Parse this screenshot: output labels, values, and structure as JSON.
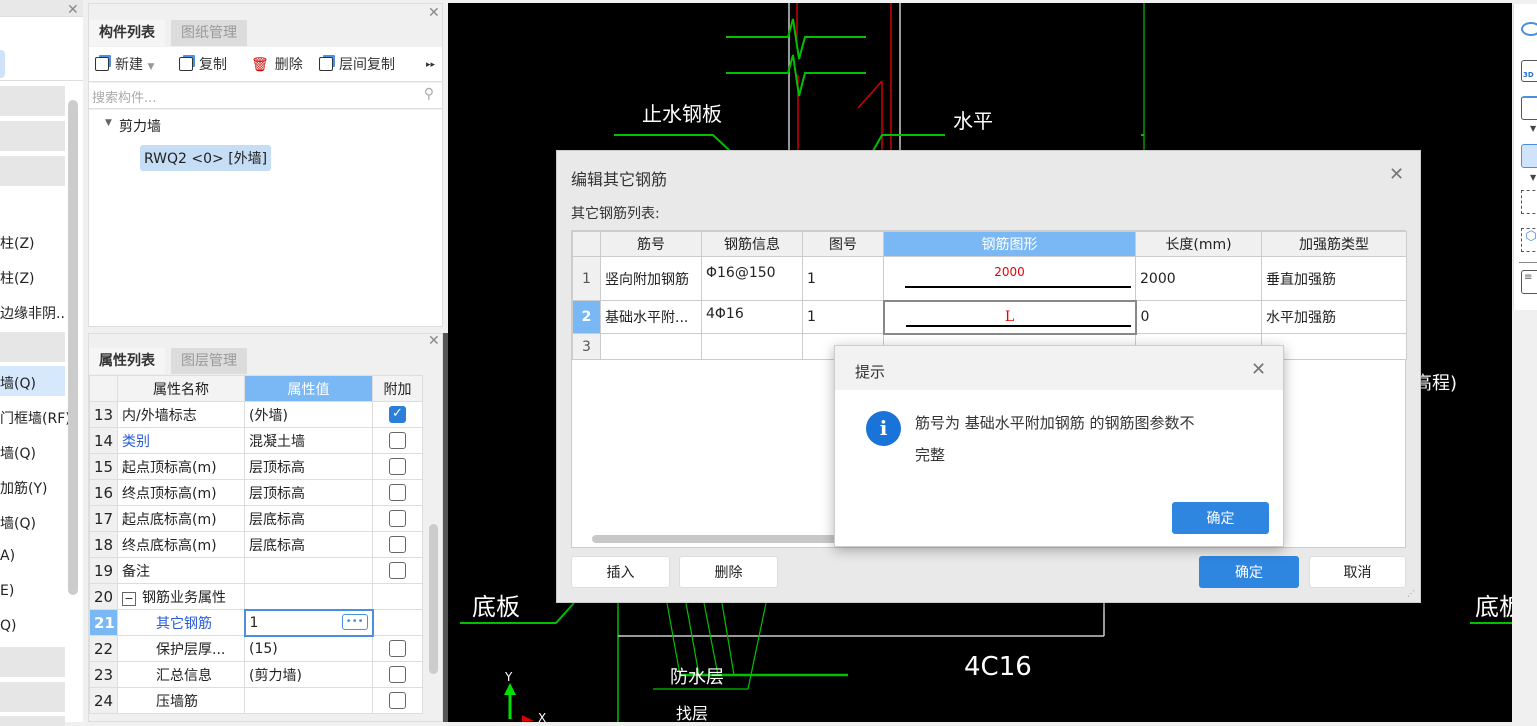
{
  "left_panel": {
    "items": [
      "柱(Z)",
      "柱(Z)",
      "边缘非阴..",
      "墙(Q)",
      "门框墙(RF)",
      "墙(Q)",
      "加筋(Y)",
      "墙(Q)",
      "A)",
      "E)",
      "Q)"
    ]
  },
  "component_panel": {
    "tabs": [
      "构件列表",
      "图纸管理"
    ],
    "toolbar": {
      "new": "新建",
      "copy": "复制",
      "delete": "删除",
      "floor_copy": "层间复制"
    },
    "search_placeholder": "搜索构件...",
    "tree": {
      "group": "剪力墙",
      "item": "RWQ2 <0> [外墙]"
    }
  },
  "property_panel": {
    "tabs": [
      "属性列表",
      "图层管理"
    ],
    "headers": [
      "属性名称",
      "属性值",
      "附加"
    ],
    "rows": [
      {
        "n": "13",
        "name": "内/外墙标志",
        "value": "(外墙)",
        "checked": true
      },
      {
        "n": "14",
        "name": "类别",
        "value": "混凝土墙",
        "checked": false
      },
      {
        "n": "15",
        "name": "起点顶标高(m)",
        "value": "层顶标高",
        "checked": false
      },
      {
        "n": "16",
        "name": "终点顶标高(m)",
        "value": "层顶标高",
        "checked": false
      },
      {
        "n": "17",
        "name": "起点底标高(m)",
        "value": "层底标高",
        "checked": false
      },
      {
        "n": "18",
        "name": "终点底标高(m)",
        "value": "层底标高",
        "checked": false
      },
      {
        "n": "19",
        "name": "备注",
        "value": "",
        "checked": false
      },
      {
        "n": "20",
        "name": "钢筋业务属性",
        "value": "",
        "group": true
      },
      {
        "n": "21",
        "name": "其它钢筋",
        "value": "1",
        "editing": true
      },
      {
        "n": "22",
        "name": "保护层厚...",
        "value": "(15)",
        "checked": false
      },
      {
        "n": "23",
        "name": "汇总信息",
        "value": "(剪力墙)",
        "checked": false
      },
      {
        "n": "24",
        "name": "压墙筋",
        "value": "",
        "checked": false
      }
    ]
  },
  "cad": {
    "labels": [
      "止水钢板",
      "水平",
      "底板",
      "底板",
      "防水层",
      "4C16",
      "找层",
      "高程)"
    ],
    "axis": [
      "Y",
      "X"
    ]
  },
  "dialog": {
    "title": "编辑其它钢筋",
    "list_label": "其它钢筋列表:",
    "headers": [
      "筋号",
      "钢筋信息",
      "图号",
      "钢筋图形",
      "长度(mm)",
      "加强筋类型"
    ],
    "rows": [
      {
        "n": "1",
        "name": "竖向附加钢筋",
        "info": "Φ16@150",
        "fig": "1",
        "shape_label": "2000",
        "length": "2000",
        "type": "垂直加强筋"
      },
      {
        "n": "2",
        "name": "基础水平附...",
        "info": "4Φ16",
        "fig": "1",
        "shape_label": "L",
        "length": "0",
        "type": "水平加强筋"
      },
      {
        "n": "3",
        "name": "",
        "info": "",
        "fig": "",
        "shape_label": "",
        "length": "",
        "type": ""
      }
    ],
    "buttons": {
      "insert": "插入",
      "delete": "删除",
      "ok": "确定",
      "cancel": "取消"
    }
  },
  "alert": {
    "title": "提示",
    "message_line1": "筋号为 基础水平附加钢筋 的钢筋图参数不",
    "message_line2": "完整",
    "ok": "确定"
  },
  "colors": {
    "accent": "#2f86e0",
    "header_selected": "#7ab8f5",
    "cad_green": "#00c000",
    "cad_red": "#d00000"
  }
}
